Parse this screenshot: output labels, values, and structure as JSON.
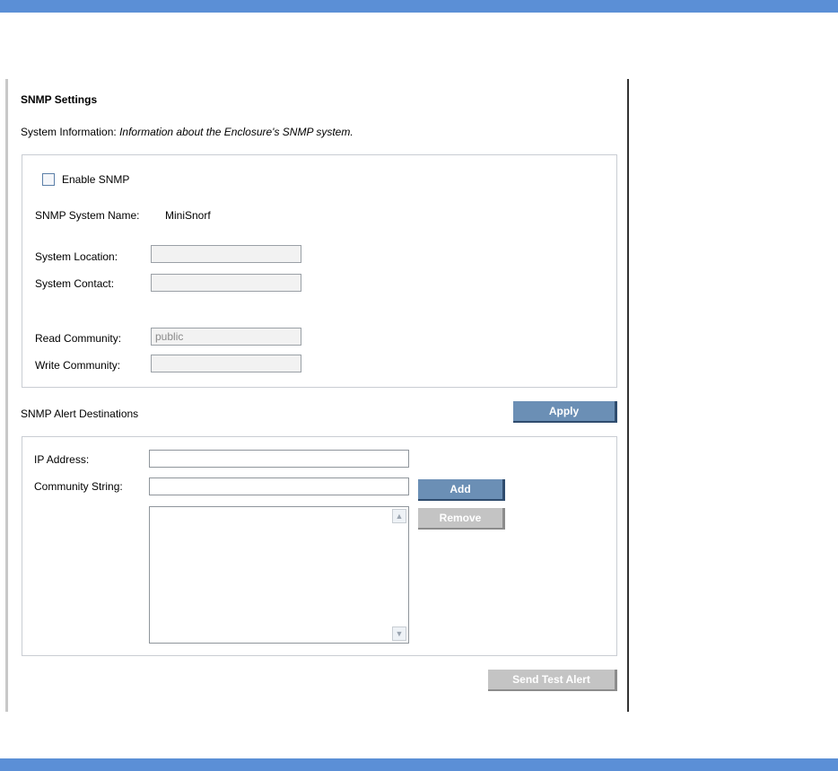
{
  "panel": {
    "title": "SNMP Settings",
    "sysinfo_label": "System Information:",
    "sysinfo_desc": "Information about the Enclosure's SNMP system."
  },
  "system": {
    "enable_label": "Enable SNMP",
    "enable_checked": false,
    "name_label": "SNMP System Name:",
    "name_value": "MiniSnorf",
    "location_label": "System Location:",
    "location_value": "",
    "contact_label": "System Contact:",
    "contact_value": "",
    "read_label": "Read Community:",
    "read_value": "public",
    "write_label": "Write Community:",
    "write_value": ""
  },
  "alerts": {
    "title": "SNMP Alert Destinations",
    "apply_label": "Apply",
    "ip_label": "IP Address:",
    "ip_value": "",
    "community_label": "Community String:",
    "community_value": "",
    "add_label": "Add",
    "remove_label": "Remove",
    "destinations": [],
    "test_label": "Send Test Alert"
  },
  "icons": {
    "scroll_up": "scroll-up-icon",
    "scroll_down": "scroll-down-icon"
  },
  "colors": {
    "banner": "#5b8fd6",
    "button_active": "#6b8fb5",
    "button_disabled": "#c4c4c4"
  }
}
